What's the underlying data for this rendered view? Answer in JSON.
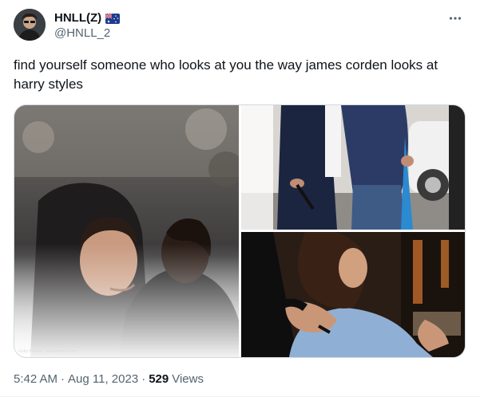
{
  "author": {
    "display_name": "HNLL(Z)",
    "handle": "@HNLL_2",
    "flag_icon": "australia-flag-icon"
  },
  "tweet": {
    "text": "find yourself someone who looks at you the way james corden looks at harry styles"
  },
  "media": {
    "photo_credit": "Getty Photos / SplashNews.com"
  },
  "meta": {
    "time": "5:42 AM",
    "separator": "·",
    "date": "Aug 11, 2023",
    "views_count": "529",
    "views_label": "Views"
  },
  "icons": {
    "more": "more-options-icon"
  },
  "colors": {
    "text_primary": "#0f1419",
    "text_secondary": "#536471",
    "border": "#cfd9de"
  }
}
